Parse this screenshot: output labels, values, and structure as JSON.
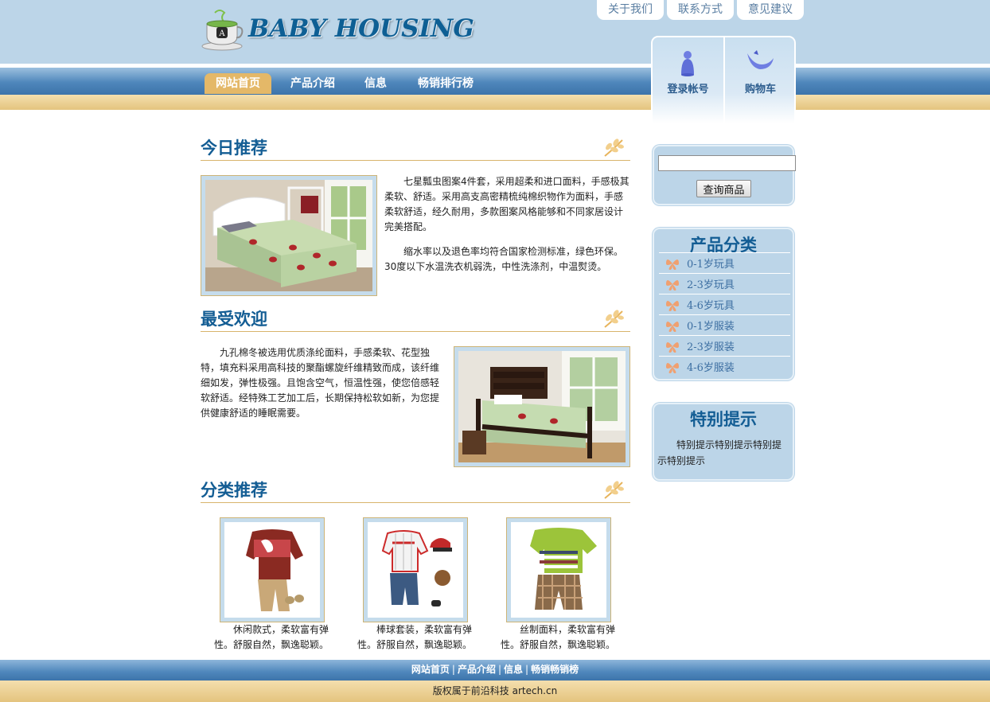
{
  "header": {
    "brand": "BABY HOUSING",
    "top_links": [
      "关于我们",
      "联系方式",
      "意见建议"
    ],
    "nav": [
      "网站首页",
      "产品介绍",
      "信息",
      "畅销排行榜"
    ],
    "user": {
      "login": "登录帐号",
      "cart": "购物车"
    }
  },
  "main": {
    "today": {
      "title": "今日推荐",
      "p1": "七星瓢虫图案4件套，采用超柔和进口面料，手感极其柔软、舒适。采用高支高密精梳纯棉织物作为面料，手感柔软舒适，经久耐用，多款图案风格能够和不同家居设计完美搭配。",
      "p2": "缩水率以及退色率均符合国家检测标准，绿色环保。30度以下水温洗衣机弱洗，中性洗涤剂，中温熨烫。"
    },
    "popular": {
      "title": "最受欢迎",
      "p1": "九孔棉冬被选用优质涤纶面料，手感柔软、花型独特，填充料采用高科技的聚酯螺旋纤维精致而成，该纤维细如发，弹性极强。且饱含空气，恒温性强，使您倍感轻软舒适。经特殊工艺加工后，长期保持松软如新，为您提供健康舒适的睡眠需要。"
    },
    "category": {
      "title": "分类推荐",
      "items": [
        {
          "text": "休闲款式，柔软富有弹性。舒服自然，飘逸聪颖。"
        },
        {
          "text": "棒球套装，柔软富有弹性。舒服自然，飘逸聪颖。"
        },
        {
          "text": "丝制面料，柔软富有弹性。舒服自然，飘逸聪颖。"
        }
      ]
    }
  },
  "sidebar": {
    "search": {
      "placeholder": "",
      "button": "查询商品"
    },
    "categories": {
      "title": "产品分类",
      "items": [
        "0-1岁玩具",
        "2-3岁玩具",
        "4-6岁玩具",
        "0-1岁服装",
        "2-3岁服装",
        "4-6岁服装"
      ]
    },
    "tip": {
      "title": "特别提示",
      "text": "特别提示特别提示特别提示特别提示"
    }
  },
  "footer": {
    "links": [
      "网站首页",
      "产品介绍",
      "信息",
      "畅销畅销榜"
    ],
    "copyright": "版权属于前沿科技 artech.cn"
  },
  "colors": {
    "sky": "#bcd5e8",
    "nav_blue": "#4e86bb",
    "gold": "#e4c47e",
    "title_blue": "#135d94"
  },
  "icons": [
    "teacup-logo-icon",
    "user-icon",
    "cart-icon",
    "leaf-ornament-icon",
    "butterfly-icon"
  ]
}
